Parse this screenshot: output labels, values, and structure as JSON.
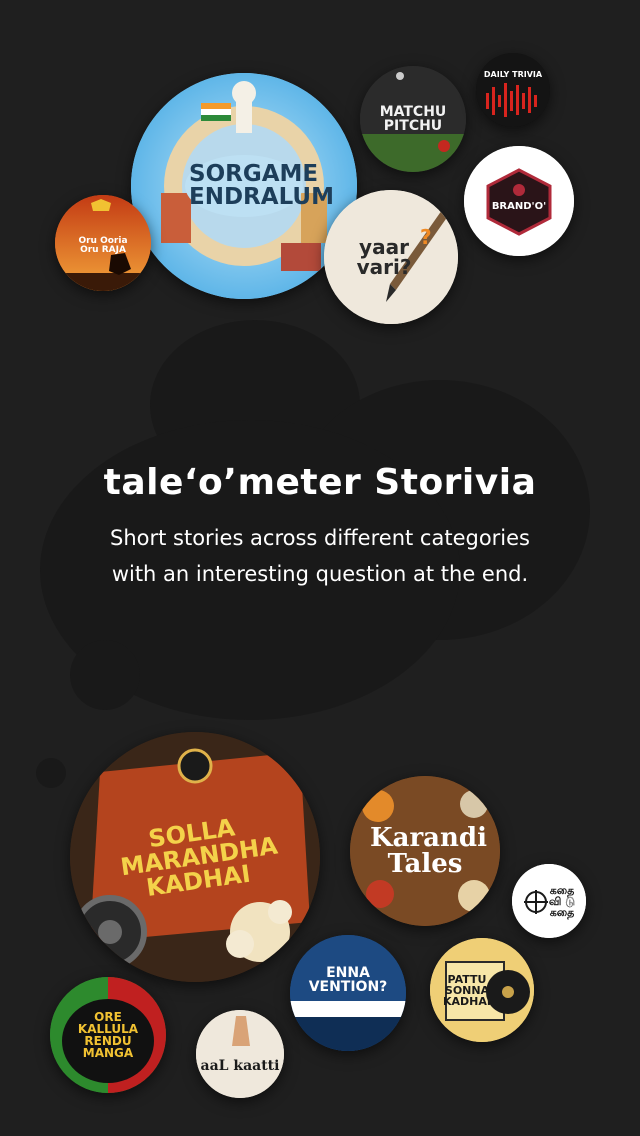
{
  "app": {
    "title": "tale‘o’meter Storivia",
    "subtitle": "Short stories across different categories with an interesting question at the end."
  },
  "shows_top": [
    {
      "id": "sorgame",
      "label": "SORGAME ENDRALUM"
    },
    {
      "id": "matchu",
      "label": "MATCHU PITCHU"
    },
    {
      "id": "daily",
      "label": "DAILY TRIVIA"
    },
    {
      "id": "brando",
      "label": "BRAND'O'"
    },
    {
      "id": "oru",
      "label": "Oru Ooria Oru RAJA"
    },
    {
      "id": "yaarvari",
      "label": "yaar vari?"
    }
  ],
  "shows_bottom": [
    {
      "id": "solla",
      "label": "SOLLA MARANDHA KADHAI"
    },
    {
      "id": "karandi",
      "label": "Karandi Tales"
    },
    {
      "id": "kathai",
      "label": "கதை வி டு கதை"
    },
    {
      "id": "enna",
      "label": "ENNA VENTION?"
    },
    {
      "id": "pattu",
      "label": "PATTU SONNA KADHAI"
    },
    {
      "id": "ore",
      "label": "ORE KALLULA RENDU MANGA"
    },
    {
      "id": "aal",
      "label": "aaL kaatti"
    }
  ],
  "colors": {
    "background": "#1f1f1f",
    "accent_orange": "#f08a24",
    "text": "#ffffff"
  }
}
